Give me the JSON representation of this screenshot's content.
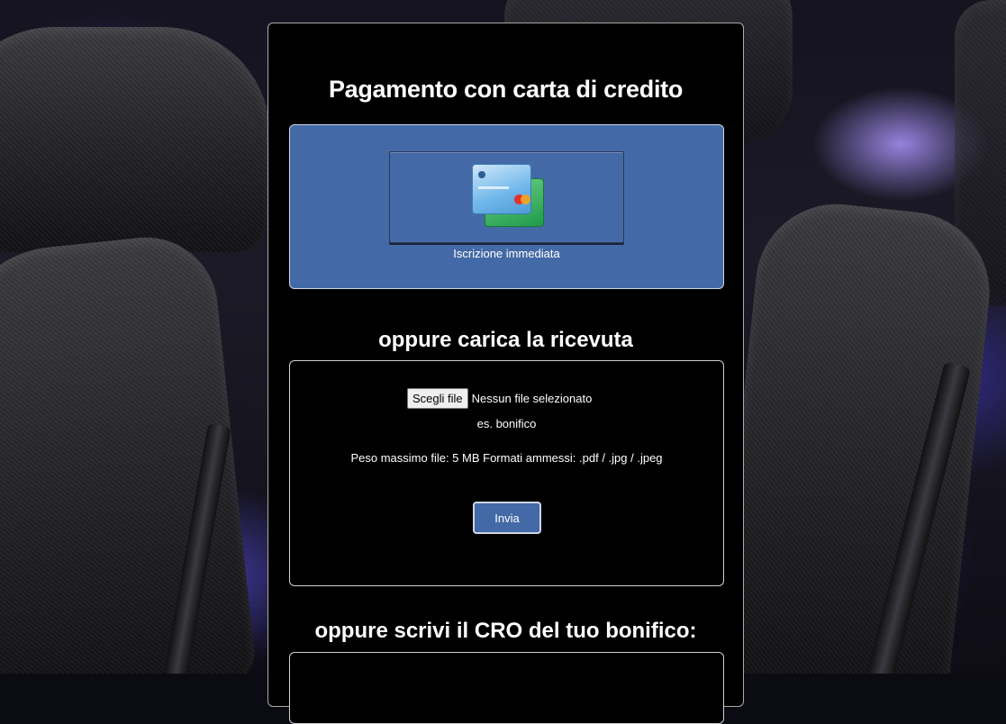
{
  "page": {
    "title": "Pagamento con carta di credito",
    "accent_color": "#436aa6"
  },
  "card_payment": {
    "icon": "credit-cards-icon",
    "caption": "Iscrizione immediata"
  },
  "upload": {
    "heading": "oppure carica la ricevuta",
    "choose_button": "Scegli file",
    "no_file_text": "Nessun file selezionato",
    "example": "es. bonifico",
    "limits": "Peso massimo file: 5 MB Formati ammessi: .pdf / .jpg / .jpeg",
    "submit_label": "Invia"
  },
  "cro": {
    "heading": "oppure scrivi il CRO del tuo bonifico:"
  }
}
